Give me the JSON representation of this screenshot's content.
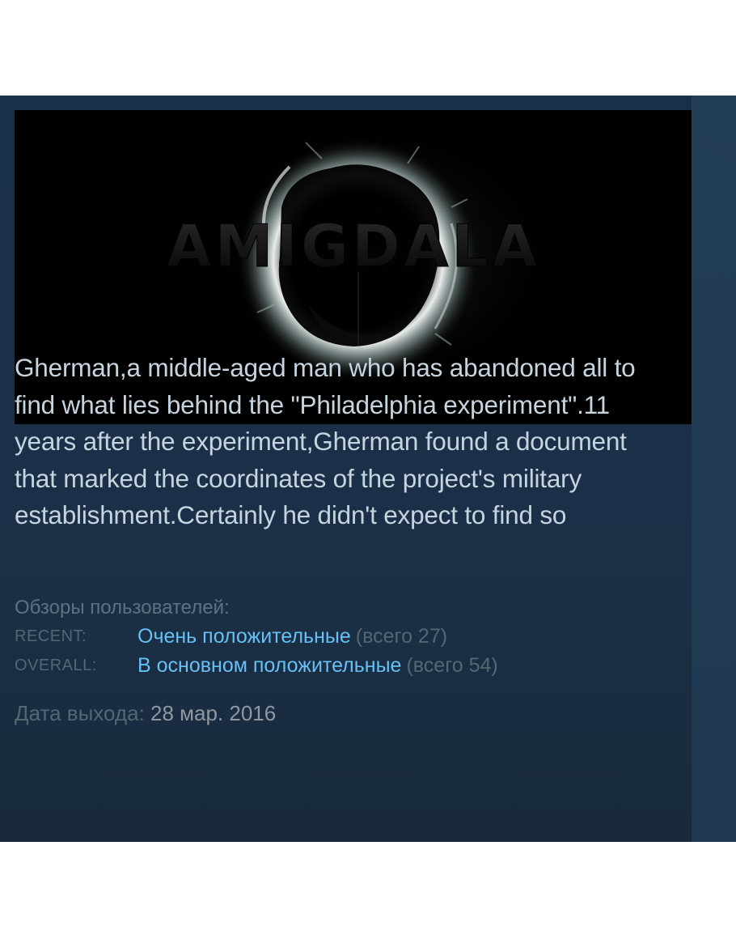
{
  "game": {
    "logo_text": "AMIGDALA",
    "description": "Gherman,a middle-aged man who has abandoned all to find what lies behind the \"Philadelphia experiment\".11 years after the experiment,Gherman found a document that marked the coordinates of the project's military establishment.Certainly he didn't expect to find so"
  },
  "reviews": {
    "title": "Обзоры пользователей:",
    "rows": [
      {
        "label": "RECENT:",
        "summary": "Очень положительные",
        "count": "(всего 27)"
      },
      {
        "label": "OVERALL:",
        "summary": "В основном положительные",
        "count": "(всего 54)"
      }
    ]
  },
  "release": {
    "label": "Дата выхода:",
    "date": "28 мар. 2016"
  },
  "colors": {
    "panel_background": "#1b3048",
    "description_text": "#c6d4df",
    "review_link": "#66c0f4",
    "muted_label": "#556772",
    "release_date": "#8f98a0"
  }
}
